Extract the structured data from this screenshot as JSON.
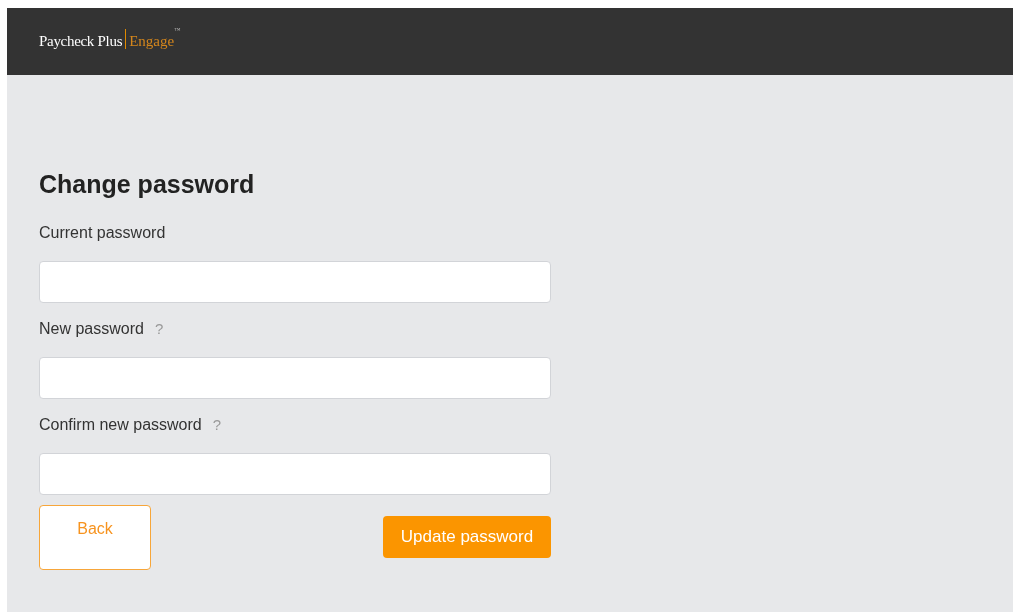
{
  "header": {
    "brand": "Paycheck Plus",
    "product": "Engage",
    "trademark": "™"
  },
  "title": "Change password",
  "fields": [
    {
      "label": "Current password"
    },
    {
      "label": "New password",
      "help": "?"
    },
    {
      "label": "Confirm new password",
      "help": "?"
    }
  ],
  "buttons": {
    "back": "Back",
    "submit": "Update password"
  }
}
